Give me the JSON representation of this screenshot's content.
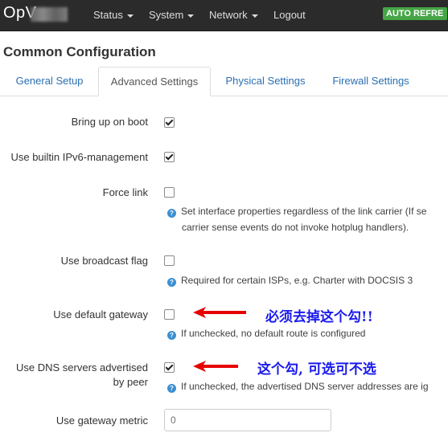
{
  "navbar": {
    "brand": "OpV",
    "menus": [
      {
        "label": "Status"
      },
      {
        "label": "System"
      },
      {
        "label": "Network"
      }
    ],
    "logout": "Logout",
    "auto_refresh": "AUTO REFRE"
  },
  "page": {
    "title": "Common Configuration"
  },
  "tabs": [
    {
      "label": "General Setup",
      "active": false
    },
    {
      "label": "Advanced Settings",
      "active": true
    },
    {
      "label": "Physical Settings",
      "active": false
    },
    {
      "label": "Firewall Settings",
      "active": false
    }
  ],
  "fields": {
    "bring_up_on_boot": {
      "label": "Bring up on boot",
      "checked": true
    },
    "builtin_ipv6": {
      "label": "Use builtin IPv6-management",
      "checked": true
    },
    "force_link": {
      "label": "Force link",
      "checked": false,
      "help_line1": "Set interface properties regardless of the link carrier (If se",
      "help_line2": "carrier sense events do not invoke hotplug handlers)."
    },
    "broadcast_flag": {
      "label": "Use broadcast flag",
      "checked": false,
      "help": "Required for certain ISPs, e.g. Charter with DOCSIS 3"
    },
    "default_gateway": {
      "label": "Use default gateway",
      "checked": false,
      "help": "If unchecked, no default route is configured"
    },
    "peer_dns": {
      "label_line1": "Use DNS servers advertised",
      "label_line2": "by peer",
      "checked": true,
      "help": "If unchecked, the advertised DNS server addresses are ig"
    },
    "gateway_metric": {
      "label": "Use gateway metric",
      "placeholder": "0"
    }
  },
  "annotations": {
    "note1": "必须去掉这个勾!!",
    "note2": "这个勾, 可选可不选",
    "arrow_color": "#e60000",
    "note_color": "#1a1aee"
  },
  "colors": {
    "navbar_bg": "#2b2b2b",
    "auto_refresh_bg": "#46a546",
    "link": "#2a6fb3",
    "help_icon": "#3b8fd1"
  }
}
